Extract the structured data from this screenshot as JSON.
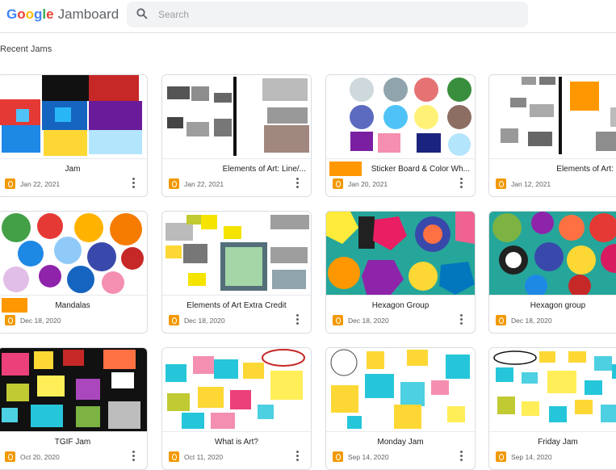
{
  "app": {
    "logo_google": "Google",
    "logo_product": "Jamboard"
  },
  "search": {
    "placeholder": "Search"
  },
  "section": {
    "title": "Recent Jams"
  },
  "cards": [
    {
      "title": "Jam",
      "date": "Jan 22, 2021"
    },
    {
      "title": "Elements of Art: Line/...",
      "date": "Jan 22, 2021"
    },
    {
      "title": "Sticker Board & Color Wh...",
      "date": "Jan 20, 2021"
    },
    {
      "title": "Elements of Art: Lin",
      "date": "Jan 12, 2021"
    },
    {
      "title": "Mandalas",
      "date": "Dec 18, 2020"
    },
    {
      "title": "Elements of Art Extra Credit",
      "date": "Dec 18, 2020"
    },
    {
      "title": "Hexagon Group",
      "date": "Dec 18, 2020"
    },
    {
      "title": "Hexagon group",
      "date": "Dec 18, 2020"
    },
    {
      "title": "TGIF Jam",
      "date": "Oct 20, 2020"
    },
    {
      "title": "What is Art?",
      "date": "Oct 11, 2020"
    },
    {
      "title": "Monday Jam",
      "date": "Sep 14, 2020"
    },
    {
      "title": "Friday Jam",
      "date": "Sep 14, 2020"
    }
  ],
  "colors": {
    "google_blue": "#4285f4",
    "google_red": "#ea4335",
    "google_yellow": "#fbbc05",
    "google_green": "#34a853",
    "jam_orange": "#f29900"
  },
  "icons": [
    "search-icon",
    "jamboard-icon",
    "more-vert-icon"
  ]
}
